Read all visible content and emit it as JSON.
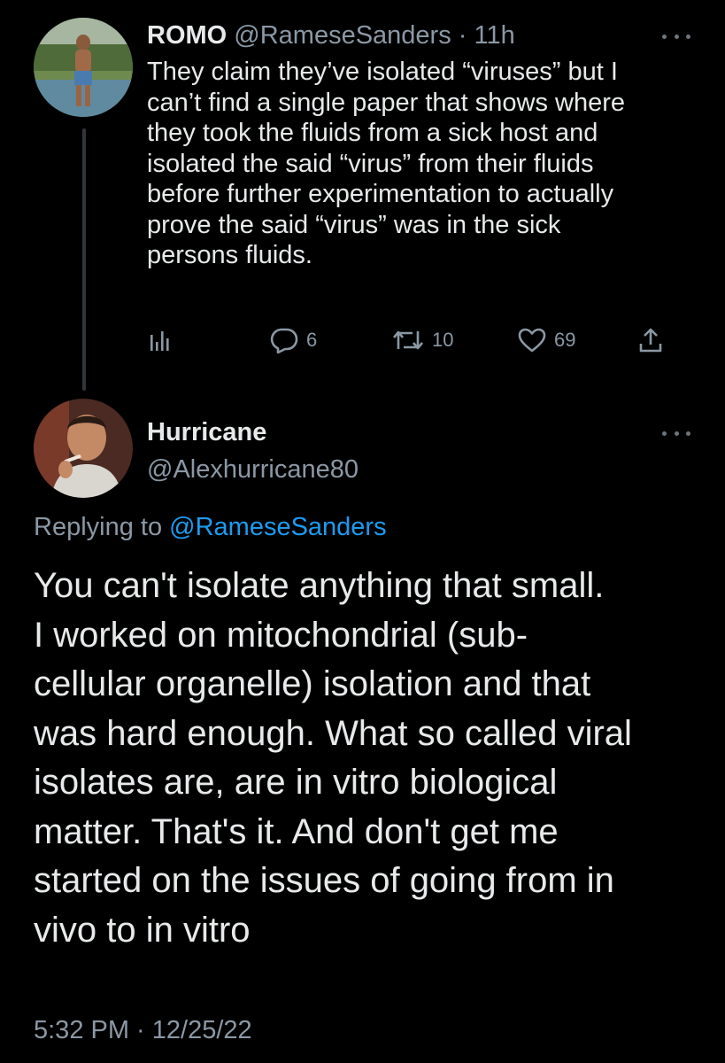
{
  "parent_tweet": {
    "display_name": "ROMO",
    "handle": "@RameseSanders",
    "separator": "·",
    "time_ago": "11h",
    "lines": [
      "They claim they’ve isolated “viruses” but I",
      "can’t find a single paper that shows where",
      "they took the fluids from a sick host and",
      "isolated the said “virus” from their fluids",
      "before further experimentation to actually",
      "prove the said “virus” was in the sick",
      "persons fluids."
    ],
    "actions": {
      "analytics_icon": "analytics-icon",
      "replies": "6",
      "retweets": "10",
      "likes": "69",
      "share_icon": "share-icon"
    }
  },
  "main_tweet": {
    "display_name": "Hurricane",
    "handle": "@Alexhurricane80",
    "replying_prefix": "Replying to",
    "replying_to": "@RameseSanders",
    "lines": [
      "You can't isolate anything that small.",
      "I worked on mitochondrial (sub-",
      "cellular organelle) isolation and that",
      "was hard enough. What so called viral",
      "isolates are, are in vitro biological",
      "matter. That's it. And don't get me",
      "started on the issues of going from in",
      "vivo to in vitro"
    ],
    "timestamp": "5:32 PM · 12/25/22"
  },
  "colors": {
    "background": "#000000",
    "text_primary": "#e7e9ea",
    "text_secondary": "#8b98a5",
    "link": "#1d9bf0",
    "thread_line": "#333639"
  }
}
